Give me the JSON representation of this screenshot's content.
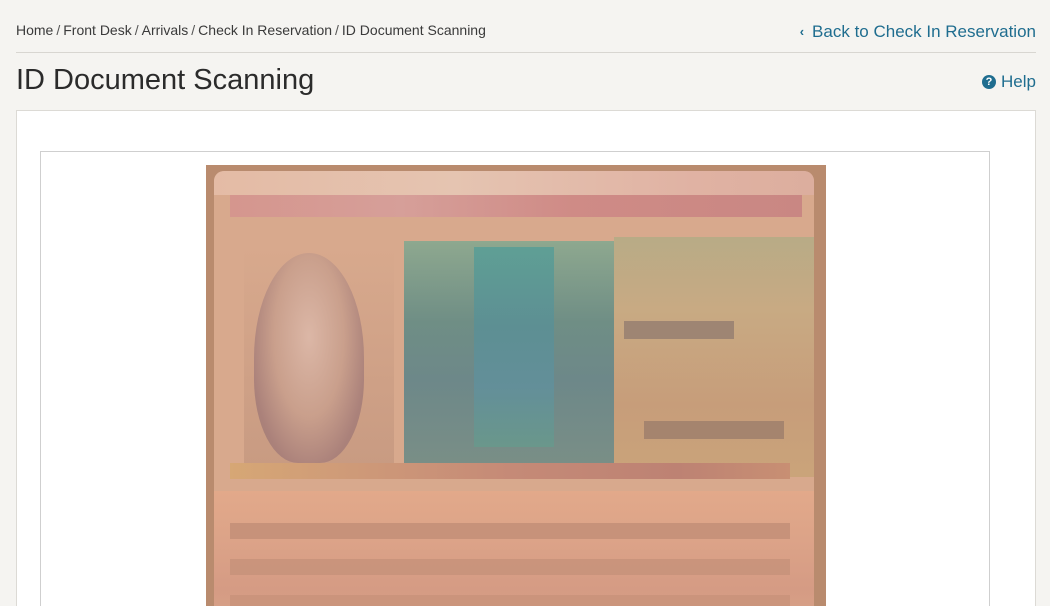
{
  "breadcrumb": {
    "items": [
      "Home",
      "Front Desk",
      "Arrivals",
      "Check In Reservation",
      "ID Document Scanning"
    ],
    "separator": "/"
  },
  "back_link": {
    "label": "Back to Check In Reservation",
    "icon": "chevron-left-icon"
  },
  "page": {
    "title": "ID Document Scanning"
  },
  "help": {
    "label": "Help",
    "icon": "question-circle-icon"
  },
  "colors": {
    "link": "#1f6d8f",
    "background": "#f5f4f1",
    "panel": "#ffffff"
  },
  "scan_image": {
    "icon": "id-card-scan-image"
  }
}
